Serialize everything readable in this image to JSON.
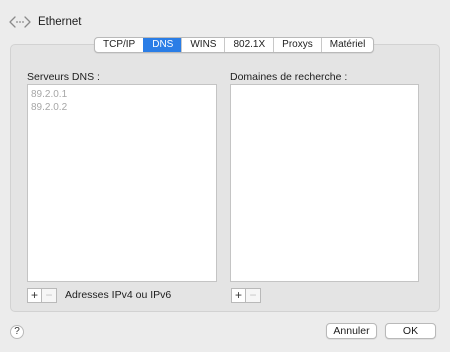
{
  "window": {
    "title": "Ethernet",
    "icon": "network-arrows-icon"
  },
  "tabs": [
    {
      "label": "TCP/IP",
      "active": false
    },
    {
      "label": "DNS",
      "active": true
    },
    {
      "label": "WINS",
      "active": false
    },
    {
      "label": "802.1X",
      "active": false
    },
    {
      "label": "Proxys",
      "active": false
    },
    {
      "label": "Matériel",
      "active": false
    }
  ],
  "dns_servers": {
    "label": "Serveurs DNS :",
    "entries": [
      "89.2.0.1",
      "89.2.0.2"
    ],
    "hint": "Adresses IPv4 ou IPv6",
    "add_label": "+",
    "remove_label": "−"
  },
  "search_domains": {
    "label": "Domaines de recherche :",
    "entries": [],
    "add_label": "+",
    "remove_label": "−"
  },
  "footer": {
    "help_label": "?",
    "cancel_label": "Annuler",
    "ok_label": "OK"
  },
  "colors": {
    "accent": "#2a7de6",
    "disabled_text": "#a6a6a6"
  }
}
